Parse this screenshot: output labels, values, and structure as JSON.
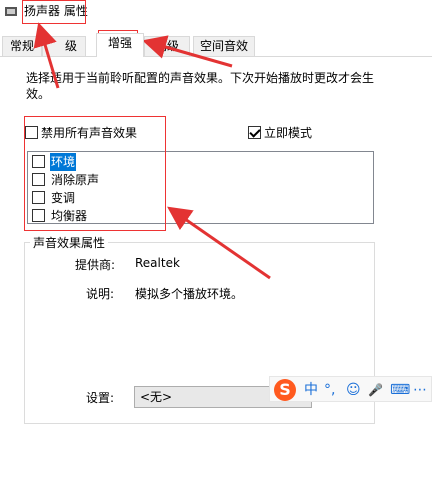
{
  "window": {
    "title": "扬声器 属性",
    "icon": "speaker-icon"
  },
  "tabs": [
    {
      "label": "常规"
    },
    {
      "label": "级别"
    },
    {
      "label": "增强",
      "active": true
    },
    {
      "label": "高级"
    },
    {
      "label": "空间音效"
    }
  ],
  "enhancements": {
    "description": "选择适用于当前聆听配置的声音效果。下次开始播放时更改才会生效。",
    "disable_all_label": "禁用所有声音效果",
    "disable_all_checked": false,
    "immediate_mode_label": "立即模式",
    "immediate_mode_checked": true,
    "effects": [
      {
        "label": "环境",
        "checked": false,
        "selected": true
      },
      {
        "label": "消除原声",
        "checked": false,
        "selected": false
      },
      {
        "label": "变调",
        "checked": false,
        "selected": false
      },
      {
        "label": "均衡器",
        "checked": false,
        "selected": false
      },
      {
        "label": "",
        "checked": false,
        "selected": false
      }
    ]
  },
  "properties": {
    "group_title": "声音效果属性",
    "provider_label": "提供商:",
    "provider_value": "Realtek",
    "description_label": "说明:",
    "description_value": "模拟多个播放环境。",
    "settings_label": "设置:",
    "settings_value": "<无>"
  },
  "ime_toolbar": {
    "logo": "S",
    "items": [
      {
        "label": "中",
        "icon": "chinese-mode-icon"
      },
      {
        "label": "°,",
        "icon": "punctuation-icon"
      },
      {
        "label": "☺",
        "icon": "emoji-icon"
      },
      {
        "label": "🎤",
        "icon": "microphone-icon"
      },
      {
        "label": "⌨",
        "icon": "keyboard-icon"
      },
      {
        "label": "⋯",
        "icon": "more-icon"
      }
    ]
  },
  "annotation_color": "#e33333"
}
